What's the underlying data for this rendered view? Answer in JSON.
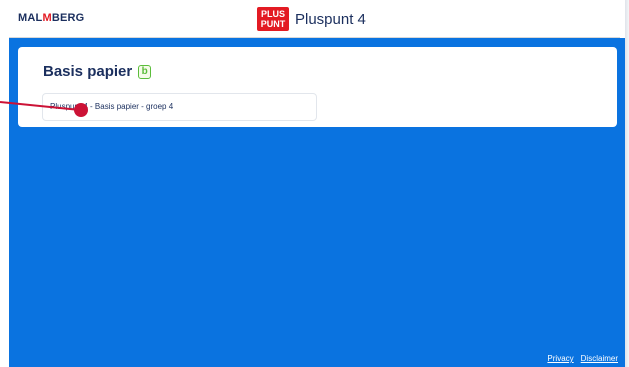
{
  "header": {
    "brand_prefix": "MAL",
    "brand_m": "M",
    "brand_suffix": "BERG",
    "product_logo_line1": "PLUS",
    "product_logo_line2": "PUNT",
    "product_title": "Pluspunt 4"
  },
  "card": {
    "title": "Basis papier",
    "badge_letter": "b",
    "item_label": "Pluspunt 4 - Basis papier - groep 4"
  },
  "footer": {
    "privacy": "Privacy",
    "disclaimer": "Disclaimer"
  },
  "colors": {
    "main_bg": "#0a73e0",
    "brand_navy": "#1b2f5e",
    "brand_red": "#e31b23",
    "annotation": "#cc1236"
  }
}
